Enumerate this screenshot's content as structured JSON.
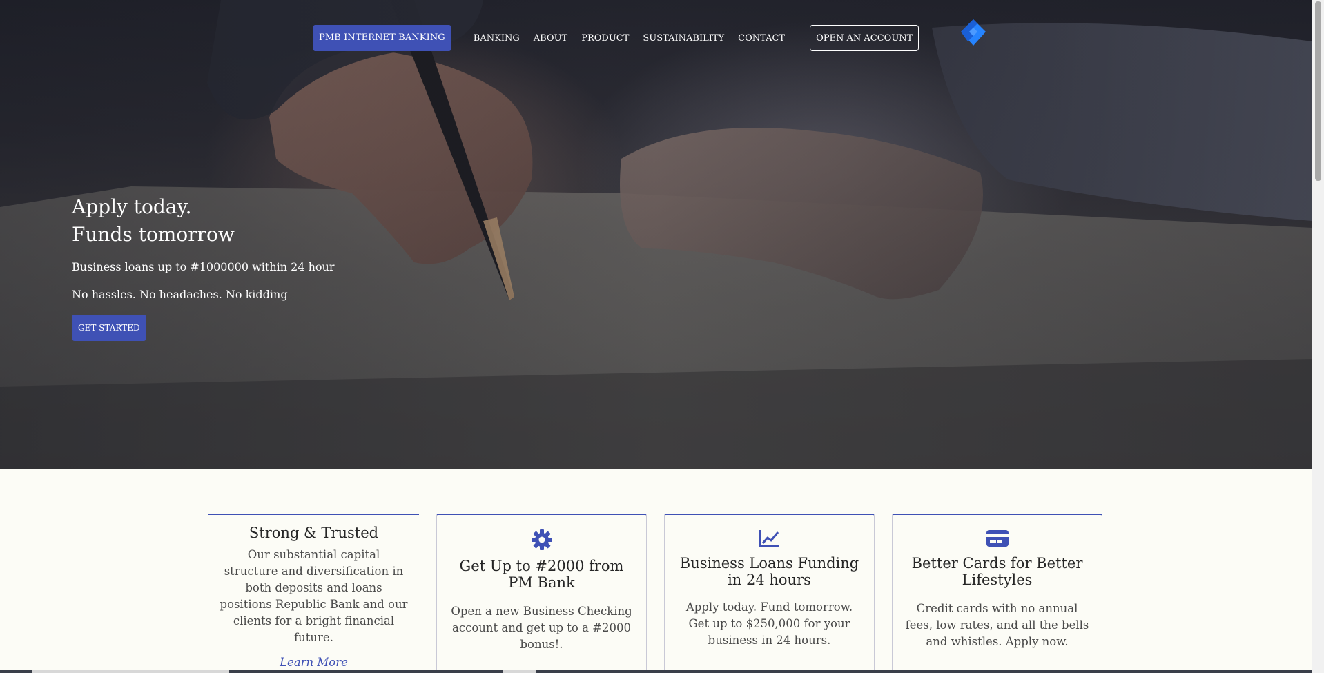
{
  "nav": {
    "brand": "PMB INTERNET BANKING",
    "links": [
      "BANKING",
      "ABOUT",
      "PRODUCT",
      "SUSTAINABILITY",
      "CONTACT"
    ],
    "account_button": "OPEN AN ACCOUNT",
    "logo_icon": "diamond-logo-icon"
  },
  "hero": {
    "title_line1": "Apply today.",
    "title_line2": "Funds tomorrow",
    "subtitle1": "Business loans up to #1000000 within 24 hour",
    "subtitle2": "No hassles. No headaches. No kidding",
    "cta": "GET STARTED",
    "image": "hand writing with pen on document"
  },
  "features": [
    {
      "title": "Strong & Trusted",
      "text": "Our substantial capital structure and diversification in both deposits and loans positions Republic Bank and our clients for a bright financial future.",
      "link": "Learn More"
    },
    {
      "icon": "gear-icon",
      "title": "Get Up to #2000 from PM Bank",
      "text": "Open a new Business Checking account and get up to a #2000 bonus!."
    },
    {
      "icon": "chart-line-icon",
      "title": "Business Loans Funding in 24 hours",
      "text": "Apply today. Fund tomorrow. Get up to $250,000 for your business in 24 hours."
    },
    {
      "icon": "credit-card-icon",
      "title": "Better Cards for Better Lifestyles",
      "text": "Credit cards with no annual fees, low rates, and all the bells and whistles. Apply now."
    }
  ],
  "colors": {
    "accent": "#3f51b5",
    "background": "#fcfcf6",
    "hero_dark": "#2c2c34",
    "logo_blue": "#2684ff"
  }
}
